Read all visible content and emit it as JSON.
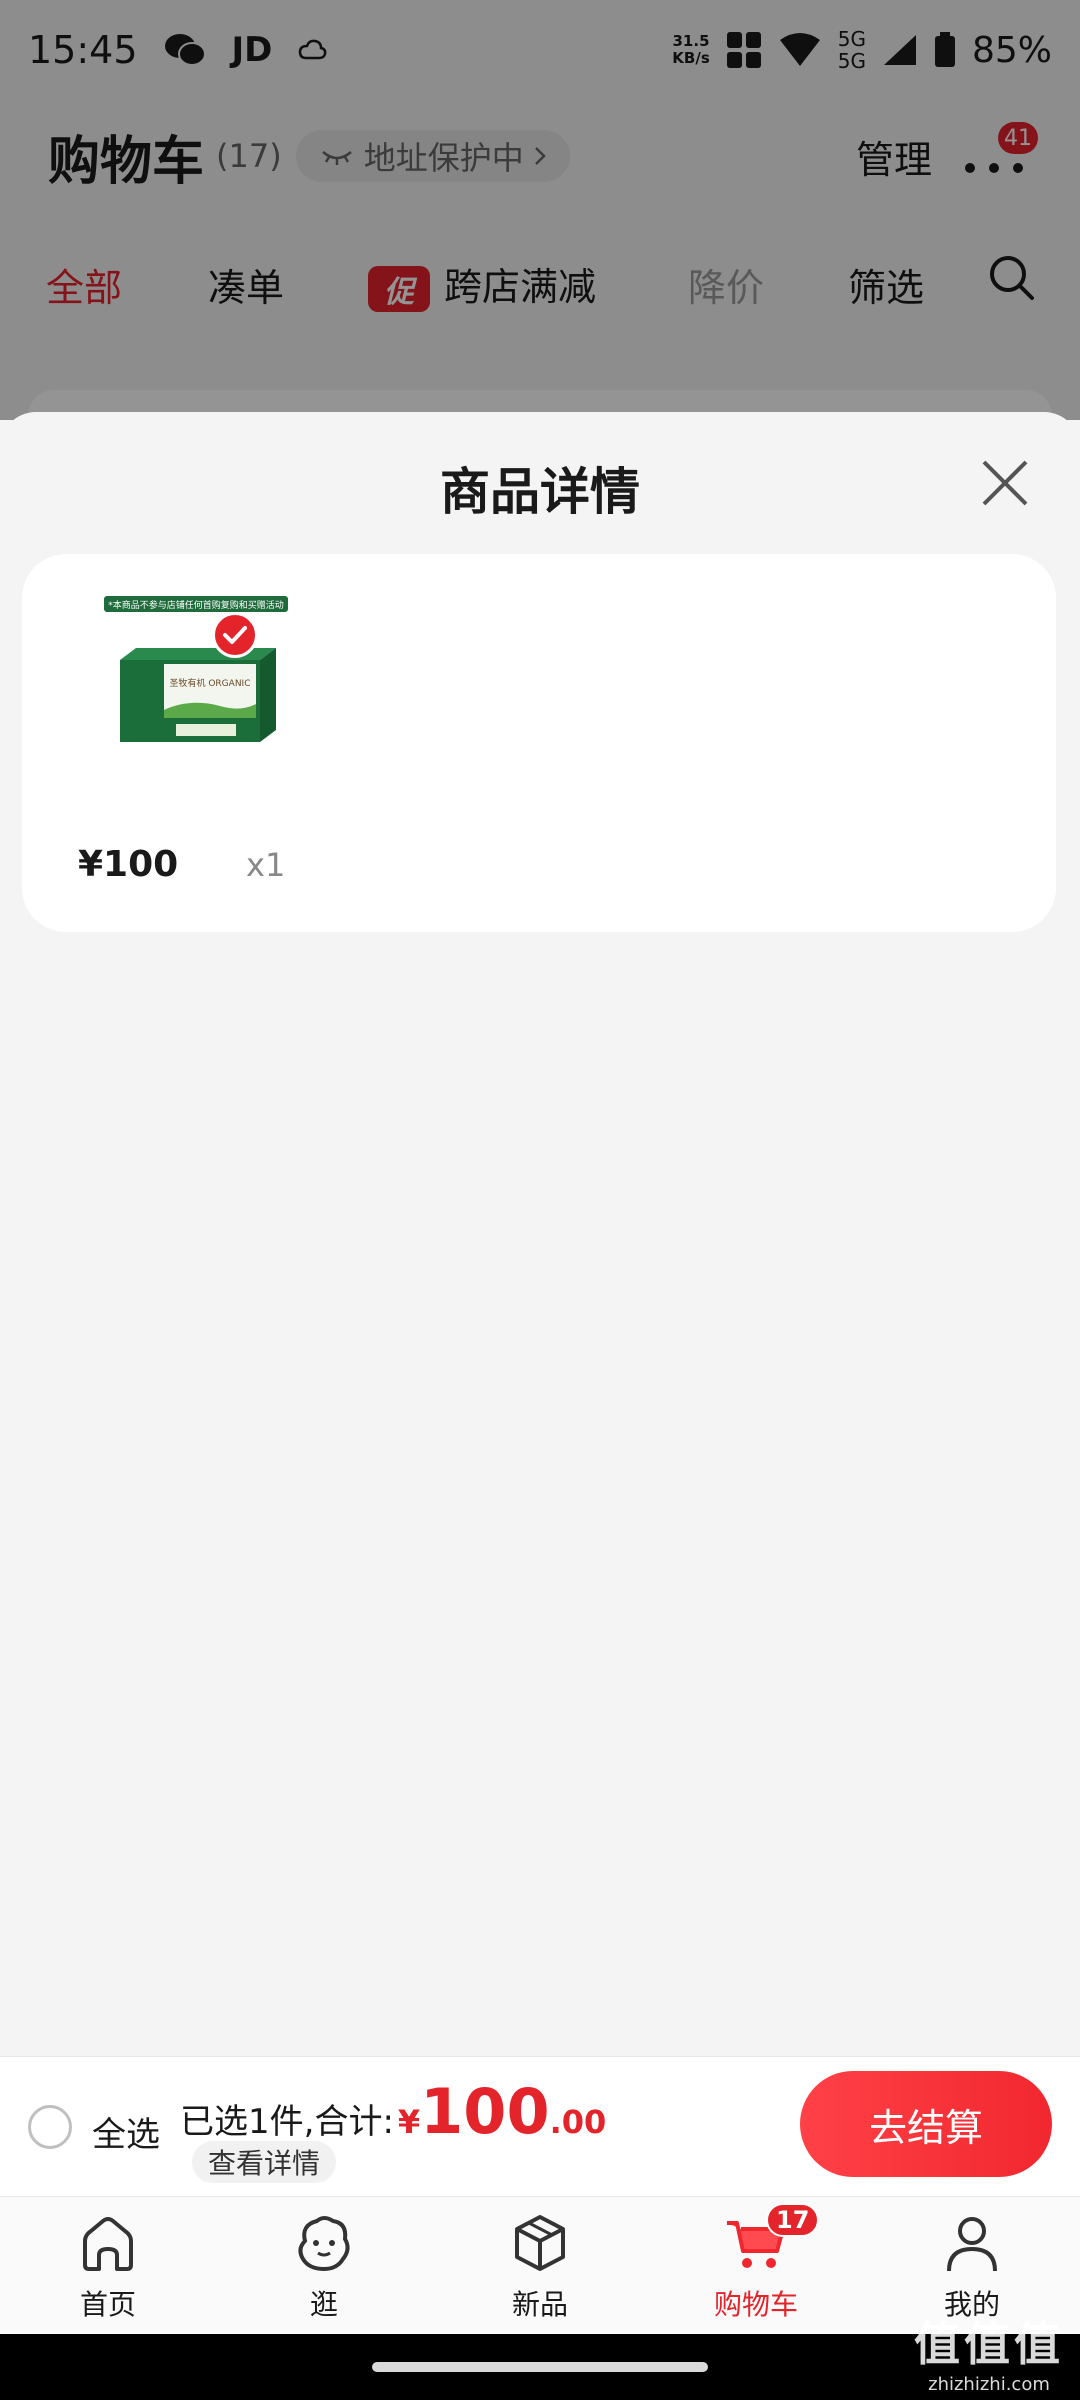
{
  "status_bar": {
    "time": "15:45",
    "app_label": "JD",
    "net_speed_value": "31.5",
    "net_speed_unit": "KB/s",
    "signal_label_top": "5G",
    "signal_label_bottom": "5G",
    "battery": "85%"
  },
  "header": {
    "title": "购物车",
    "count": "(17)",
    "address_pill": "地址保护中",
    "manage": "管理",
    "more_badge": "41"
  },
  "filter_tabs": [
    {
      "label": "全部",
      "active": true
    },
    {
      "label": "凑单"
    },
    {
      "promo_tag": "促",
      "label": "跨店满减"
    },
    {
      "label": "降价",
      "muted": true
    },
    {
      "label": "筛选"
    }
  ],
  "sheet": {
    "title": "商品详情",
    "product": {
      "thumb_banner": "*本商品不参与店铺任何首购复购和买赠活动",
      "thumb_brand": "圣牧有机 ORGANIC",
      "price": "¥100",
      "quantity": "x1"
    }
  },
  "checkout": {
    "select_all": "全选",
    "summary": "已选1件,合计:",
    "total_currency": "¥",
    "total_integer": "100",
    "total_decimal": ".00",
    "detail_link": "查看详情",
    "button": "去结算"
  },
  "tab_bar": {
    "tabs": [
      {
        "label": "首页",
        "icon": "home-icon"
      },
      {
        "label": "逛",
        "icon": "discover-icon"
      },
      {
        "label": "新品",
        "icon": "cube-icon"
      },
      {
        "label": "购物车",
        "icon": "cart-icon",
        "active": true,
        "badge": "17"
      },
      {
        "label": "我的",
        "icon": "person-icon"
      }
    ]
  },
  "watermark": {
    "big": "值值值",
    "small": "zhizhizhi.com"
  },
  "colors": {
    "accent": "#e3242b",
    "background": "#f4f4f4",
    "card": "#ffffff"
  }
}
